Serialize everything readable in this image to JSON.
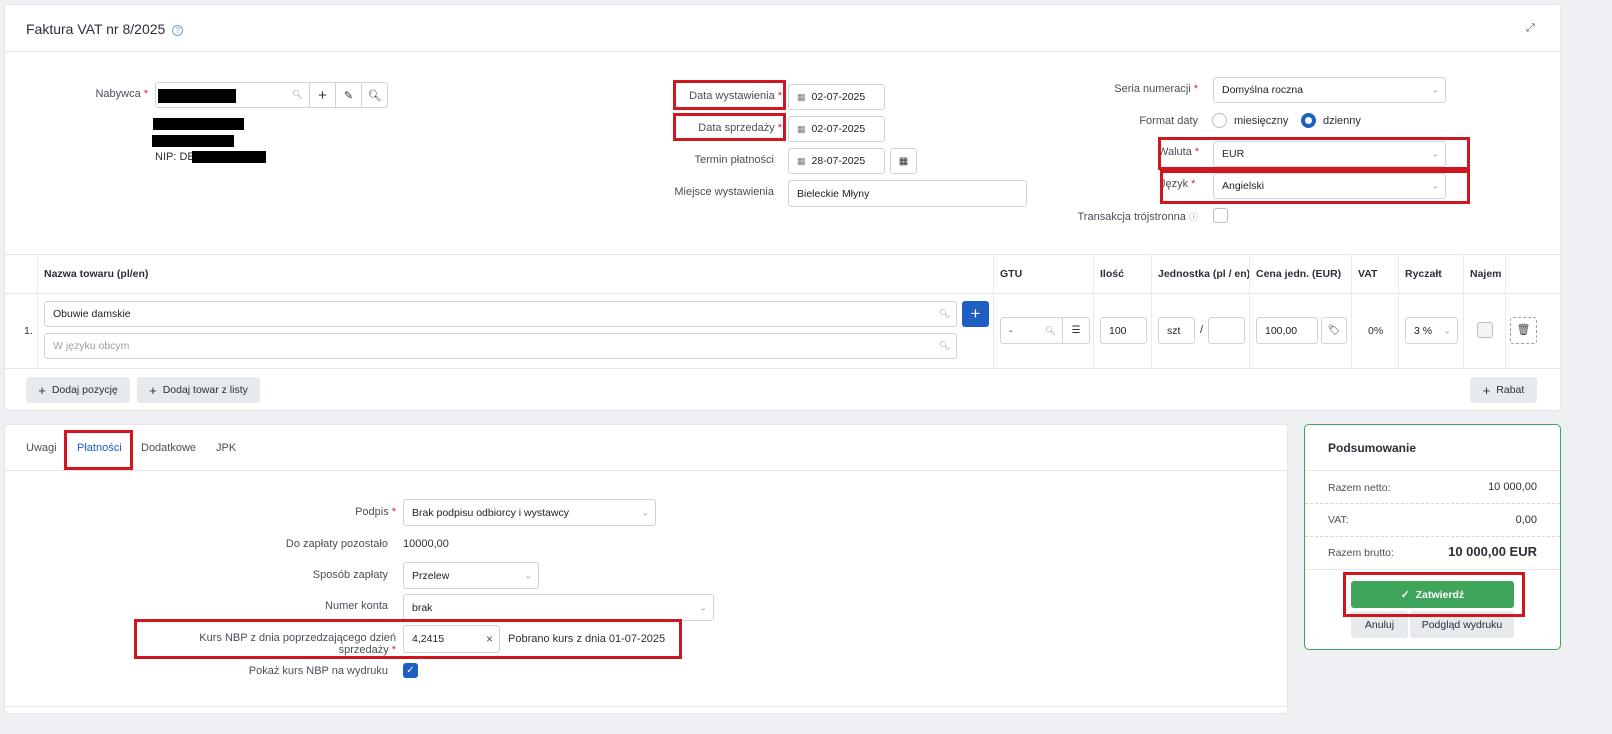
{
  "header": {
    "title": "Faktura VAT nr 8/2025"
  },
  "buyer": {
    "label": "Nabywca",
    "nip_prefix": "NIP: DE"
  },
  "dates": {
    "issue_label": "Data wystawienia",
    "issue_value": "02-07-2025",
    "sale_label": "Data sprzedaży",
    "sale_value": "02-07-2025",
    "due_label": "Termin płatności",
    "due_value": "28-07-2025",
    "place_label": "Miejsce wystawienia",
    "place_value": "Bieleckie Młyny"
  },
  "settings": {
    "series_label": "Seria numeracji",
    "series_value": "Domyślna roczna",
    "format_label": "Format daty",
    "format_monthly": "miesięczny",
    "format_daily": "dzienny",
    "currency_label": "Waluta",
    "currency_value": "EUR",
    "language_label": "Język",
    "language_value": "Angielski",
    "triangular_label": "Transakcja trójstronna"
  },
  "table": {
    "headers": {
      "name": "Nazwa towaru (pl/en)",
      "gtu": "GTU",
      "qty": "Ilość",
      "unit": "Jednostka (pl / en)",
      "price": "Cena jedn. (EUR)",
      "vat": "VAT",
      "lump": "Ryczałt",
      "rent": "Najem"
    },
    "row": {
      "index": "1.",
      "name": "Obuwie damskie",
      "foreign_placeholder": "W języku obcym",
      "gtu": "-",
      "qty": "100",
      "unit": "szt",
      "unit_sep": "/",
      "price": "100,00",
      "vat": "0%",
      "lump": "3 %"
    },
    "add_item": "Dodaj pozycję",
    "add_from_list": "Dodaj towar z listy",
    "discount": "Rabat"
  },
  "tabs": [
    "Uwagi",
    "Płatności",
    "Dodatkowe",
    "JPK"
  ],
  "payment": {
    "signature_label": "Podpis",
    "signature_value": "Brak podpisu odbiorcy i wystawcy",
    "remaining_label": "Do zapłaty pozostało",
    "remaining_value": "10000,00",
    "method_label": "Sposób zapłaty",
    "method_value": "Przelew",
    "account_label": "Numer konta",
    "account_value": "brak",
    "rate_label": "Kurs NBP z dnia poprzedzającego dzień sprzedaży",
    "rate_value": "4,2415",
    "rate_note": "Pobrano kurs z dnia 01-07-2025",
    "show_rate_label": "Pokaż kurs NBP na wydruku"
  },
  "summary": {
    "title": "Podsumowanie",
    "net_label": "Razem netto:",
    "net_value": "10 000,00",
    "vat_label": "VAT:",
    "vat_value": "0,00",
    "gross_label": "Razem brutto:",
    "gross_value": "10 000,00 EUR",
    "confirm": "Zatwierdź",
    "cancel": "Anuluj",
    "preview": "Podgląd wydruku"
  },
  "colors": {
    "accent": "#1f5fc1",
    "confirm": "#3fa55a",
    "highlight": "#d0161e"
  }
}
